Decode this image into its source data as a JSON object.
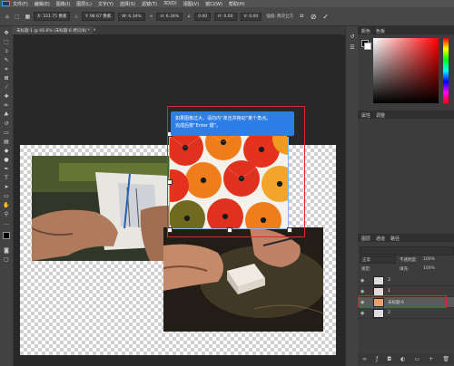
{
  "menubar": {
    "items": [
      "文件(F)",
      "编辑(E)",
      "图像(I)",
      "图层(L)",
      "文字(Y)",
      "选择(S)",
      "滤镜(T)",
      "3D(D)",
      "视图(V)",
      "窗口(W)",
      "帮助(H)"
    ]
  },
  "optionsbar": {
    "x_value": "X: 331.75 像素",
    "y_value": "Y: 98.67 像素",
    "w_value": "W: 6.34%",
    "h_value": "H: 6.34%",
    "angle_value": "0.00",
    "h_skew": "H: 0.00",
    "v_skew": "V: 0.00",
    "interp_label": "插值: 两次立方"
  },
  "document": {
    "tab_label": "未标题-1 @ 66.6% (未标题-6 拷贝/8) *"
  },
  "tooltip": {
    "line1": "如果图像过大，请向内“单击并拖动”某个角点。",
    "line2": "完成后按“Enter 键”。"
  },
  "panels": {
    "color_tab": "颜色",
    "swatches_tab": "色板",
    "properties_tab": "属性",
    "adjustments_tab": "调整",
    "layers_tab": "图层",
    "channels_tab": "通道",
    "paths_tab": "路径",
    "blend_mode": "正常",
    "opacity_label": "不透明度:",
    "opacity_value": "100%",
    "fill_label": "填充:",
    "fill_value": "100%",
    "lock_label": "锁定:"
  },
  "layers": [
    {
      "name": "3",
      "active": false
    },
    {
      "name": "1",
      "active": false
    },
    {
      "name": "未标题-6",
      "active": true
    },
    {
      "name": "2",
      "active": false
    }
  ],
  "colors": {
    "accent_blue": "#2d7ee6",
    "highlight_red": "#e0262b"
  }
}
